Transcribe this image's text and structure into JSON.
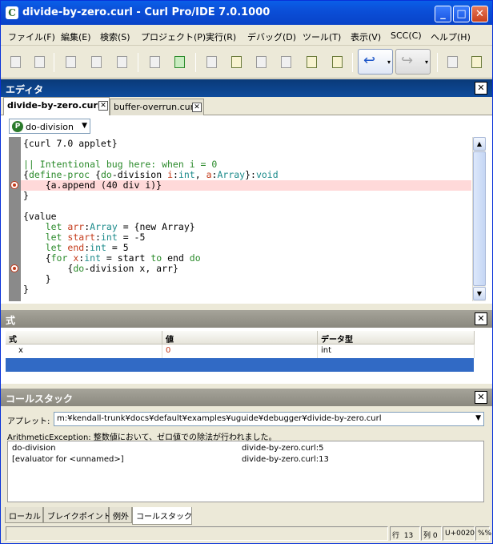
{
  "window": {
    "title": "divide-by-zero.curl - Curl Pro/IDE 7.0.1000",
    "app_icon": "curl-logo-icon"
  },
  "menu": [
    "ファイル(F)",
    "編集(E)",
    "検索(S)",
    "プロジェクト(P)",
    "実行(R)",
    "デバッグ(D)",
    "ツール(T)",
    "表示(V)",
    "SCC(C)",
    "ヘルプ(H)"
  ],
  "editor": {
    "panel_title": "エディタ",
    "tabs": [
      {
        "label": "divide-by-zero.curl",
        "active": true
      },
      {
        "label": "buffer-overrun.curl",
        "active": false
      }
    ],
    "proc_selector": "do-division",
    "code_lines": [
      "{curl 7.0 applet}",
      "",
      "|| Intentional bug here: when i = 0",
      "{define-proc {do-division i:int, a:Array}:void",
      "    {a.append (40 div i)}",
      "}",
      "",
      "{value",
      "    let arr:Array = {new Array}",
      "    let start:int = -5",
      "    let end:int = 5",
      "    {for x:int = start to end do",
      "        {do-division x, arr}",
      "    }",
      "}"
    ],
    "highlighted_line": 4,
    "breakpoint_lines": [
      4,
      12
    ]
  },
  "expressions": {
    "panel_title": "式",
    "columns": [
      "式",
      "値",
      "データ型"
    ],
    "rows": [
      {
        "expr": "x",
        "value": "0",
        "type": "int"
      }
    ],
    "value_color": "#c43a1a"
  },
  "callstack": {
    "panel_title": "コールスタック",
    "applet_label": "アプレット:",
    "applet_path": "m:¥kendall-trunk¥docs¥default¥examples¥uguide¥debugger¥divide-by-zero.curl",
    "error": "ArithmeticException: 整数値において、ゼロ値での除法が行われました。",
    "frames": [
      {
        "name": "do-division",
        "location": "divide-by-zero.curl:5"
      },
      {
        "name": "[evaluator for <unnamed>]",
        "location": "divide-by-zero.curl:13"
      }
    ]
  },
  "bottom_tabs": [
    {
      "label": "ローカル",
      "active": false
    },
    {
      "label": "ブレイクポイント",
      "active": false
    },
    {
      "label": "例外",
      "active": false
    },
    {
      "label": "コールスタック",
      "active": true
    }
  ],
  "status": {
    "row_label": "行",
    "row": "13",
    "col_label": "列",
    "col": "0",
    "char": "U+0020",
    "extra": "%%"
  }
}
